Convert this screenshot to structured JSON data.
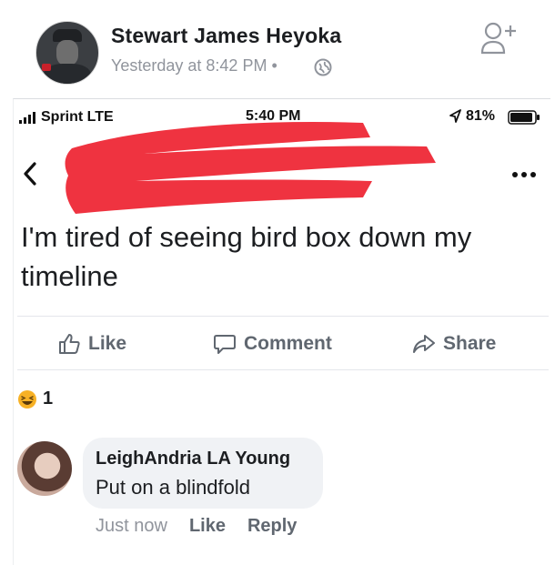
{
  "post_header": {
    "author_name": "Stewart James Heyoka",
    "timestamp": "Yesterday at 8:42 PM",
    "separator": "•"
  },
  "status_bar": {
    "carrier": "Sprint  LTE",
    "time": "5:40 PM",
    "battery_percent": "81%"
  },
  "post": {
    "text": "I'm tired of seeing bird box down my timeline"
  },
  "actions": {
    "like_label": "Like",
    "comment_label": "Comment",
    "share_label": "Share"
  },
  "reactions": {
    "count": "1",
    "type": "haha-icon"
  },
  "comment": {
    "author": "LeighAndria LA Young",
    "text": "Put on a blindfold",
    "time": "Just now",
    "like_label": "Like",
    "reply_label": "Reply"
  },
  "colors": {
    "redaction": "#ef3340",
    "secondary_text": "#606770",
    "bubble": "#f0f2f5"
  }
}
